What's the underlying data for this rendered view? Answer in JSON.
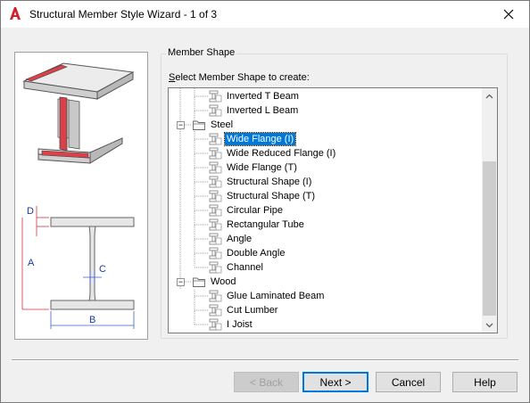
{
  "window": {
    "title": "Structural Member Style Wizard - 1 of 3",
    "app_icon": "autocad-a-icon",
    "close_glyph": "✕"
  },
  "diagram": {
    "dim_d": "D",
    "dim_a": "A",
    "dim_c": "C",
    "dim_b": "B"
  },
  "group": {
    "title": "Member Shape",
    "prompt_prefix": "",
    "prompt_mnemonic": "S",
    "prompt_rest": "elect Member Shape to create:"
  },
  "tree": {
    "items": [
      {
        "label": "Inverted T Beam"
      },
      {
        "label": "Inverted L Beam"
      },
      {
        "label": "Steel",
        "type": "folder",
        "expanded": true
      },
      {
        "label": "Wide Flange (I)",
        "selected": true
      },
      {
        "label": "Wide Reduced Flange (I)"
      },
      {
        "label": "Wide Flange (T)"
      },
      {
        "label": "Structural Shape (I)"
      },
      {
        "label": "Structural Shape (T)"
      },
      {
        "label": "Circular Pipe"
      },
      {
        "label": "Rectangular Tube"
      },
      {
        "label": "Angle"
      },
      {
        "label": "Double Angle"
      },
      {
        "label": "Channel"
      },
      {
        "label": "Wood",
        "type": "folder",
        "expanded": true
      },
      {
        "label": "Glue Laminated Beam"
      },
      {
        "label": "Cut Lumber"
      },
      {
        "label": "I Joist"
      }
    ],
    "expander_minus": "−"
  },
  "buttons": {
    "back_label": "< Back",
    "next_label": "Next >",
    "cancel_label": "Cancel",
    "help_label": "Help"
  },
  "colors": {
    "selection": "#0078d7",
    "dimension_red": "#d0343a",
    "dimension_blue": "#3a62c8"
  }
}
